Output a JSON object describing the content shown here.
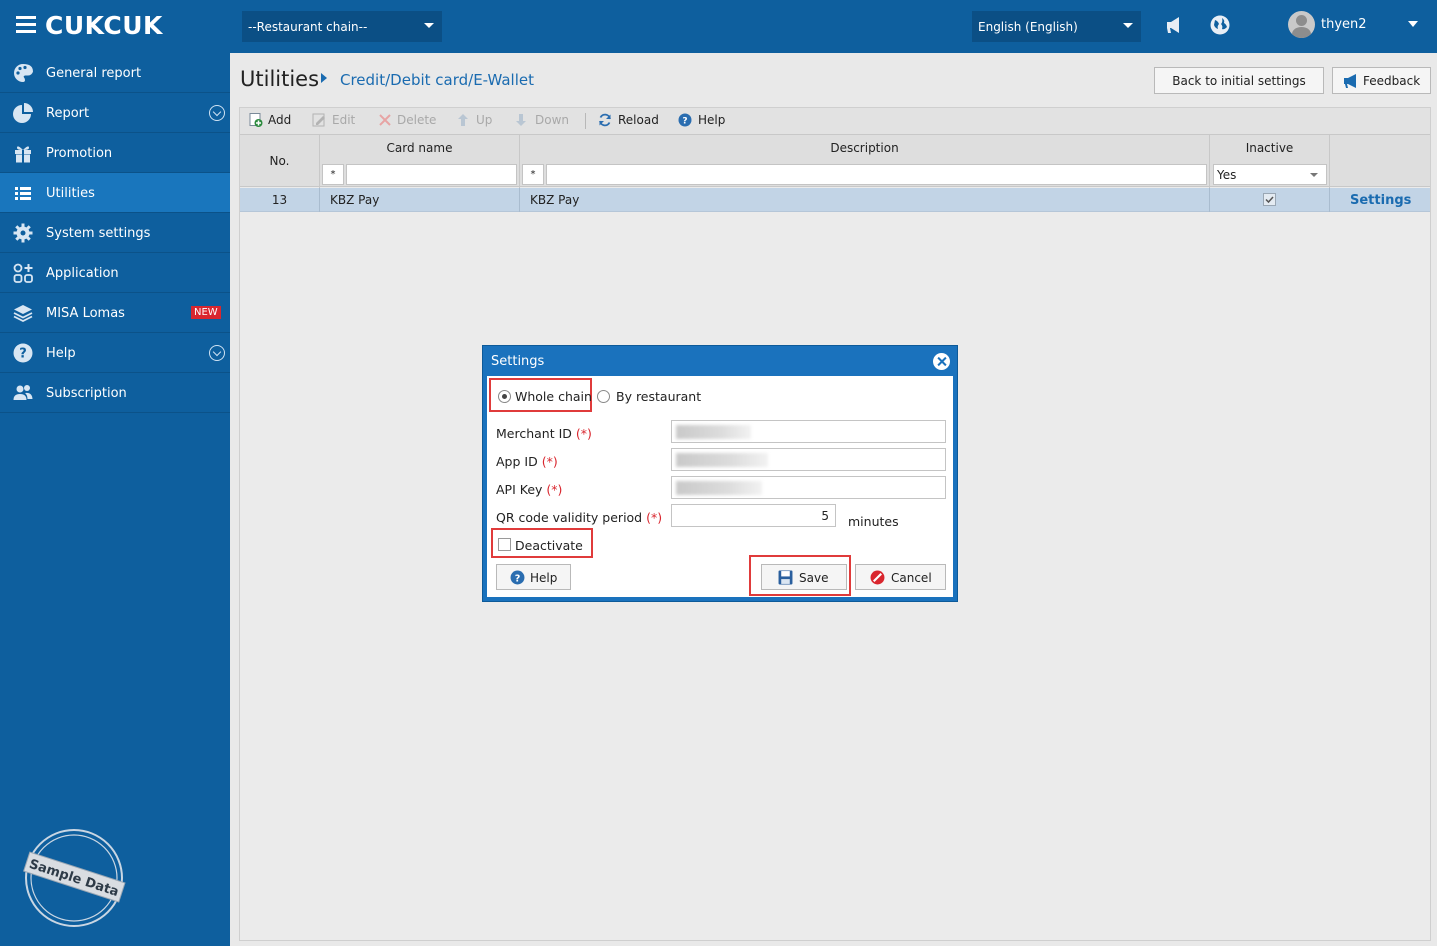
{
  "topbar": {
    "brand": "CUKCUK",
    "chain_select": "--Restaurant chain--",
    "language_select": "English (English)",
    "username": "thyen2"
  },
  "sidebar": {
    "items": [
      {
        "label": "General report",
        "icon": "palette-icon"
      },
      {
        "label": "Report",
        "icon": "pie-chart-icon"
      },
      {
        "label": "Promotion",
        "icon": "gift-icon"
      },
      {
        "label": "Utilities",
        "icon": "list-icon"
      },
      {
        "label": "System settings",
        "icon": "gear-icon"
      },
      {
        "label": "Application",
        "icon": "apps-grid-icon"
      },
      {
        "label": "MISA Lomas",
        "icon": "layers-icon",
        "badge": "NEW"
      },
      {
        "label": "Help",
        "icon": "question-icon"
      },
      {
        "label": "Subscription",
        "icon": "users-icon"
      }
    ],
    "active": "Utilities",
    "stamp_text": "Sample Data"
  },
  "page": {
    "title": "Utilities",
    "breadcrumb": "Credit/Debit card/E-Wallet",
    "back_button": "Back to initial settings",
    "feedback_button": "Feedback"
  },
  "toolbar": {
    "add": "Add",
    "edit": "Edit",
    "delete": "Delete",
    "up": "Up",
    "down": "Down",
    "reload": "Reload",
    "help": "Help"
  },
  "grid": {
    "columns": {
      "no": "No.",
      "card_name": "Card name",
      "description": "Description",
      "inactive": "Inactive"
    },
    "filters": {
      "card_name_op": "*",
      "description_op": "*",
      "inactive_value": "Yes"
    },
    "rows": [
      {
        "no": "13",
        "card_name": "KBZ Pay",
        "description": "KBZ Pay",
        "inactive": true,
        "action": "Settings"
      }
    ]
  },
  "dialog": {
    "title": "Settings",
    "scope_whole_chain": "Whole chain",
    "scope_by_restaurant": "By restaurant",
    "merchant_id_label": "Merchant ID",
    "app_id_label": "App ID",
    "api_key_label": "API Key",
    "qr_label": "QR code validity period",
    "required_mark": "(*)",
    "qr_value": "5",
    "qr_unit": "minutes",
    "deactivate_label": "Deactivate",
    "help_button": "Help",
    "save_button": "Save",
    "cancel_button": "Cancel"
  },
  "colors": {
    "primary": "#0e5f9e",
    "active_nav": "#1976bd",
    "link": "#1a6bb0",
    "highlight": "#e03b3b",
    "selected_row": "#c2d4e6"
  }
}
